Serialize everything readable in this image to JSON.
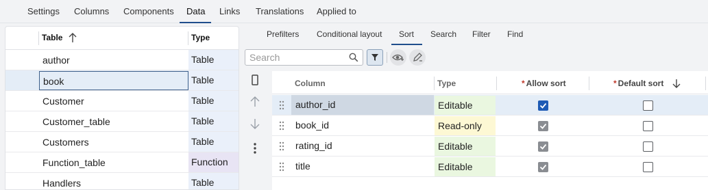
{
  "top_tabs": [
    {
      "label": "Settings"
    },
    {
      "label": "Columns"
    },
    {
      "label": "Components"
    },
    {
      "label": "Data"
    },
    {
      "label": "Links"
    },
    {
      "label": "Translations"
    },
    {
      "label": "Applied to"
    }
  ],
  "active_top_tab": "Data",
  "left_table": {
    "headers": {
      "table": "Table",
      "type": "Type"
    },
    "rows": [
      {
        "name": "author",
        "type": "Table"
      },
      {
        "name": "book",
        "type": "Table"
      },
      {
        "name": "Customer",
        "type": "Table"
      },
      {
        "name": "Customer_table",
        "type": "Table"
      },
      {
        "name": "Customers",
        "type": "Table"
      },
      {
        "name": "Function_table",
        "type": "Function"
      },
      {
        "name": "Handlers",
        "type": "Table"
      }
    ],
    "selected_row": "book"
  },
  "sub_tabs": [
    {
      "label": "Prefilters"
    },
    {
      "label": "Conditional layout"
    },
    {
      "label": "Sort"
    },
    {
      "label": "Search"
    },
    {
      "label": "Filter"
    },
    {
      "label": "Find"
    }
  ],
  "active_sub_tab": "Sort",
  "search": {
    "placeholder": "Search",
    "value": ""
  },
  "toolbar_icons": [
    "search-icon",
    "filter-icon",
    "visibility-icon",
    "edit-icon"
  ],
  "side_icons": [
    "select-column-icon",
    "move-up-icon",
    "move-down-icon",
    "more-icon"
  ],
  "sort_table": {
    "headers": {
      "column": "Column",
      "type": "Type",
      "allow_sort": "Allow sort",
      "default_sort": "Default sort",
      "required_marker": "*"
    },
    "rows": [
      {
        "column": "author_id",
        "type": "Editable",
        "allow_sort": true,
        "default_sort": false
      },
      {
        "column": "book_id",
        "type": "Read-only",
        "allow_sort": true,
        "default_sort": false
      },
      {
        "column": "rating_id",
        "type": "Editable",
        "allow_sort": true,
        "default_sort": false
      },
      {
        "column": "title",
        "type": "Editable",
        "allow_sort": true,
        "default_sort": false
      }
    ],
    "selected_row": "author_id"
  },
  "colors": {
    "accent": "#1f4e8c",
    "checkbox_active": "#1e5bb5",
    "checkbox_disabled": "#8a8d92",
    "editable_bg": "#eaf7e0",
    "readonly_bg": "#fdf8d4",
    "table_type_bg": "#eaf0fa",
    "function_type_bg": "#e8e4f4",
    "required_marker": "#c0392b"
  }
}
